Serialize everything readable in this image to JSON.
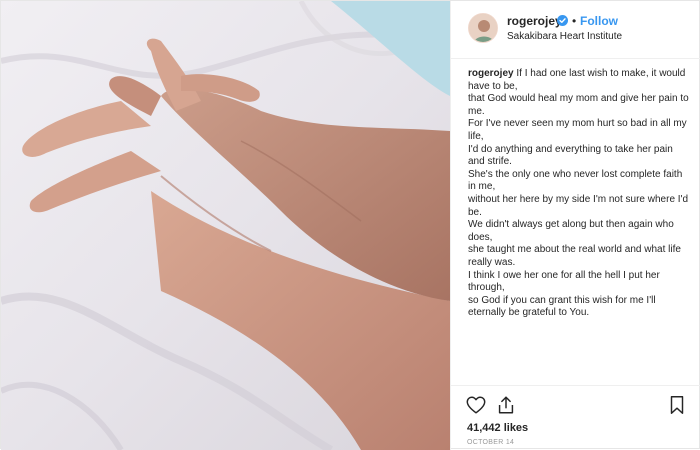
{
  "header": {
    "username": "rogerojey",
    "separator": "•",
    "follow_label": "Follow",
    "location": "Sakakibara Heart Institute",
    "verified_icon": "verified-badge-icon",
    "avatar_icon": "avatar"
  },
  "caption": {
    "username": "rogerojey",
    "lines": [
      "If I had one last wish to make, it would have to be,",
      "that God would heal my mom and give her pain to me.",
      "For I've never seen my mom hurt so bad in all my life,",
      "I'd do anything and everything to take her pain and strife.",
      "She's the only one who never lost complete faith in me,",
      "without her here by my side I'm not sure where I'd be.",
      "We didn't always get along but then again who does,",
      "she taught me about the real world and what life really was.",
      "I think I owe her one for all the hell I put her through,",
      "so God if you can grant this wish for me I'll eternally be grateful to You."
    ]
  },
  "actions": {
    "like_icon": "heart-icon",
    "share_icon": "share-icon",
    "save_icon": "bookmark-icon",
    "likes": "41,442 likes",
    "date": "OCTOBER 14"
  },
  "colors": {
    "link_blue": "#3897f0",
    "text": "#262626",
    "muted": "#999999",
    "border": "#efefef"
  }
}
